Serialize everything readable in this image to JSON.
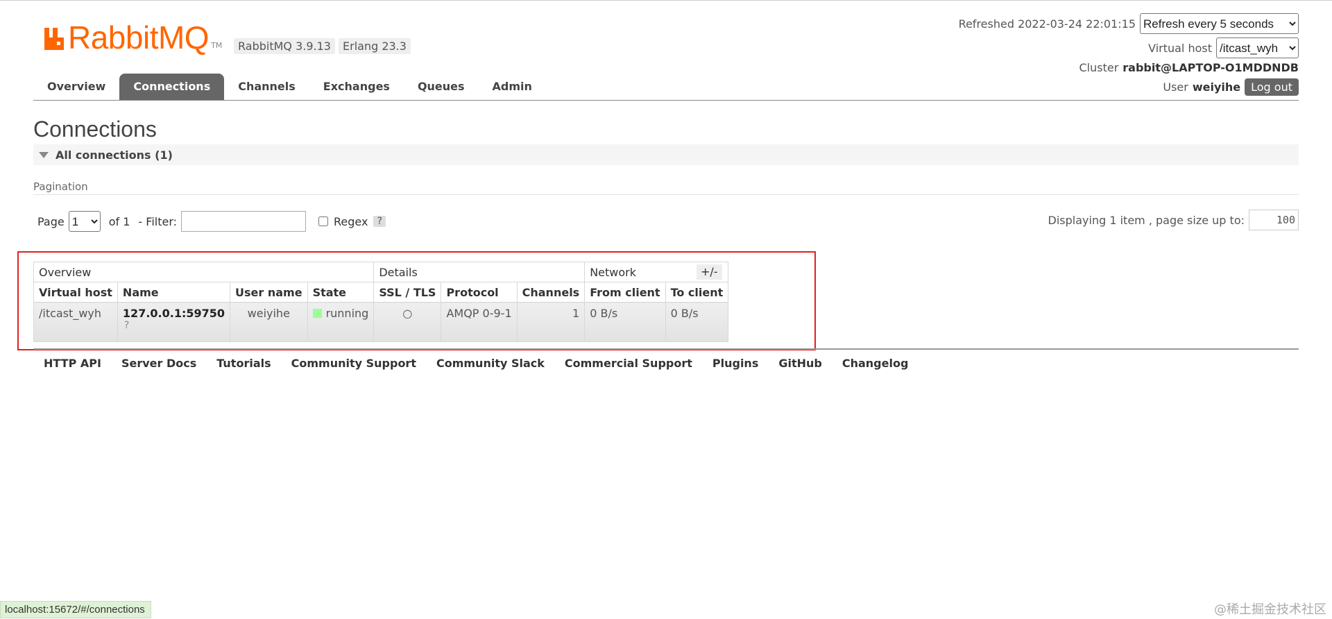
{
  "header": {
    "logo_text": "RabbitMQ",
    "logo_tm": "TM",
    "version_badges": [
      "RabbitMQ 3.9.13",
      "Erlang 23.3"
    ],
    "refreshed_label": "Refreshed 2022-03-24 22:01:15",
    "refresh_select_value": "Refresh every 5 seconds",
    "virtual_host_label": "Virtual host",
    "virtual_host_value": "/itcast_wyh",
    "cluster_label": "Cluster",
    "cluster_value": "rabbit@LAPTOP-O1MDDNDB",
    "user_label": "User",
    "user_value": "weiyihe",
    "logout_label": "Log out"
  },
  "tabs": [
    {
      "label": "Overview",
      "active": false
    },
    {
      "label": "Connections",
      "active": true
    },
    {
      "label": "Channels",
      "active": false
    },
    {
      "label": "Exchanges",
      "active": false
    },
    {
      "label": "Queues",
      "active": false
    },
    {
      "label": "Admin",
      "active": false
    }
  ],
  "main": {
    "title": "Connections",
    "section_title": "All connections (1)",
    "pagination_label": "Pagination",
    "pager": {
      "page_label": "Page",
      "page_value": "1",
      "of_label": "of 1",
      "filter_label": "- Filter:",
      "filter_value": "",
      "regex_label": "Regex",
      "help": "?",
      "display_label": "Displaying 1 item , page size up to:",
      "page_size": "100"
    },
    "table": {
      "groups": [
        "Overview",
        "Details",
        "Network"
      ],
      "columns": [
        "Virtual host",
        "Name",
        "User name",
        "State",
        "SSL / TLS",
        "Protocol",
        "Channels",
        "From client",
        "To client"
      ],
      "rows": [
        {
          "vhost": "/itcast_wyh",
          "name": "127.0.0.1:59750",
          "name_sub": "?",
          "user": "weiyihe",
          "state": "running",
          "ssl": "○",
          "protocol": "AMQP 0-9-1",
          "channels": "1",
          "from_client": "0 B/s",
          "to_client": "0 B/s"
        }
      ],
      "plus_minus": "+/-"
    }
  },
  "footer": {
    "links": [
      "HTTP API",
      "Server Docs",
      "Tutorials",
      "Community Support",
      "Community Slack",
      "Commercial Support",
      "Plugins",
      "GitHub",
      "Changelog"
    ]
  },
  "statusbar": {
    "url": "localhost:15672/#/connections",
    "watermark": "@稀土掘金技术社区"
  },
  "colors": {
    "brand": "#ff6600",
    "active_tab": "#666666",
    "highlight_box": "#e02020",
    "running": "#99ff99"
  }
}
